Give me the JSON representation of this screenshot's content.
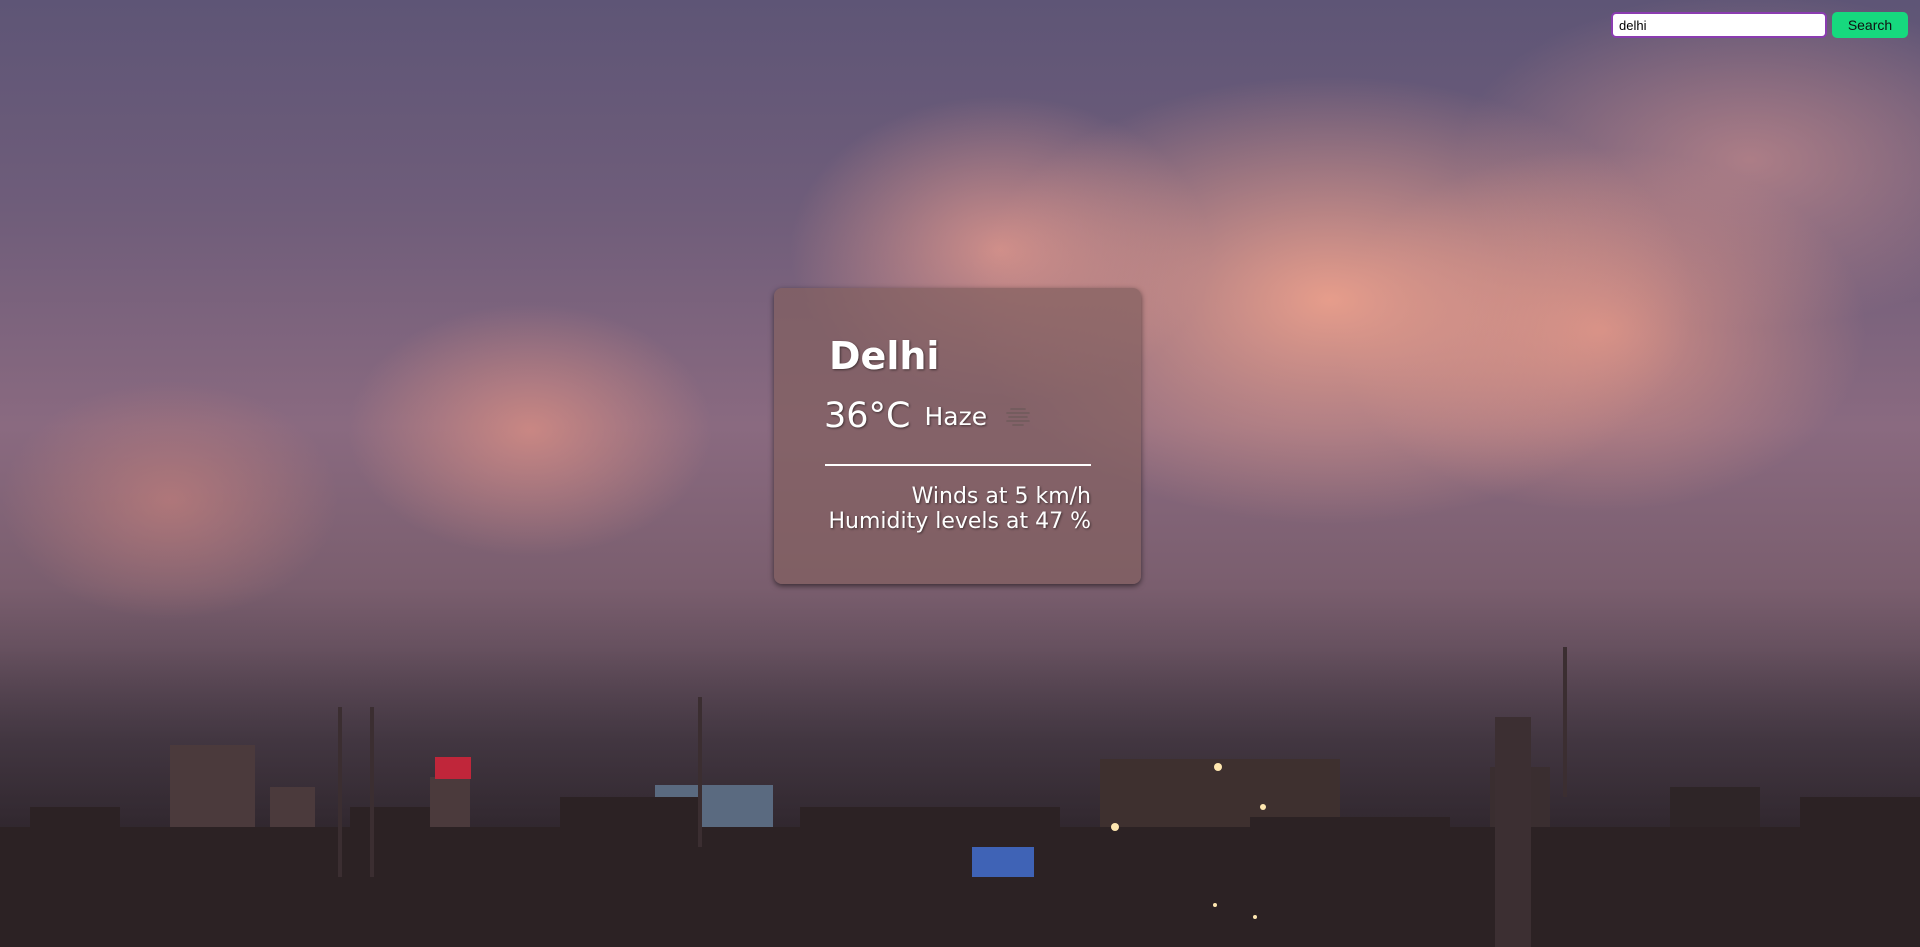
{
  "search": {
    "value": "delhi",
    "button_label": "Search"
  },
  "weather": {
    "city": "Delhi",
    "temperature": "36°C",
    "condition": "Haze",
    "condition_icon": "haze-icon",
    "wind": "Winds at 5 km/h",
    "humidity": "Humidity levels at 47 %"
  },
  "colors": {
    "search_button": "#16d97e",
    "search_input_border": "#8a3cb0",
    "card_background": "#826060"
  }
}
